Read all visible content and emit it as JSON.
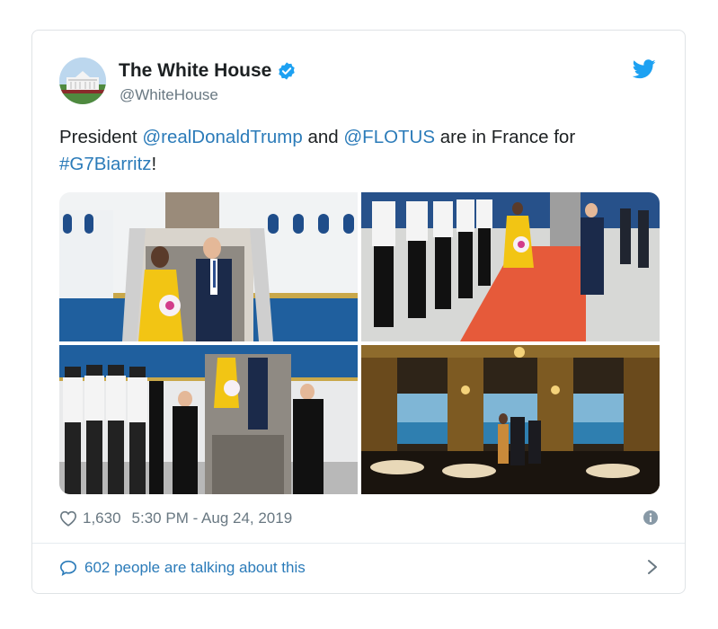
{
  "author": {
    "name": "The White House",
    "handle": "@WhiteHouse",
    "verified": true
  },
  "tweet": {
    "prefix": "President ",
    "mention1": "@realDonaldTrump",
    "mid": " and ",
    "mention2": "@FLOTUS",
    "mid2": " are in France for ",
    "hashtag": "#G7Biarritz",
    "suffix": "!"
  },
  "media": [
    {
      "name": "photo-airplane-steps"
    },
    {
      "name": "photo-red-carpet"
    },
    {
      "name": "photo-honor-guard"
    },
    {
      "name": "photo-window-view"
    }
  ],
  "meta": {
    "likes": "1,630",
    "timestamp": "5:30 PM - Aug 24, 2019"
  },
  "conversation": {
    "label": "602 people are talking about this"
  },
  "icons": {
    "verified": "verified-badge-icon",
    "bird": "twitter-bird-icon",
    "heart": "heart-icon",
    "info": "info-icon",
    "reply": "reply-bubble-icon",
    "chevron": "chevron-right-icon"
  },
  "colors": {
    "link": "#2b7bb9",
    "text": "#1c2022",
    "muted": "#697882",
    "brand": "#1da1f2"
  }
}
